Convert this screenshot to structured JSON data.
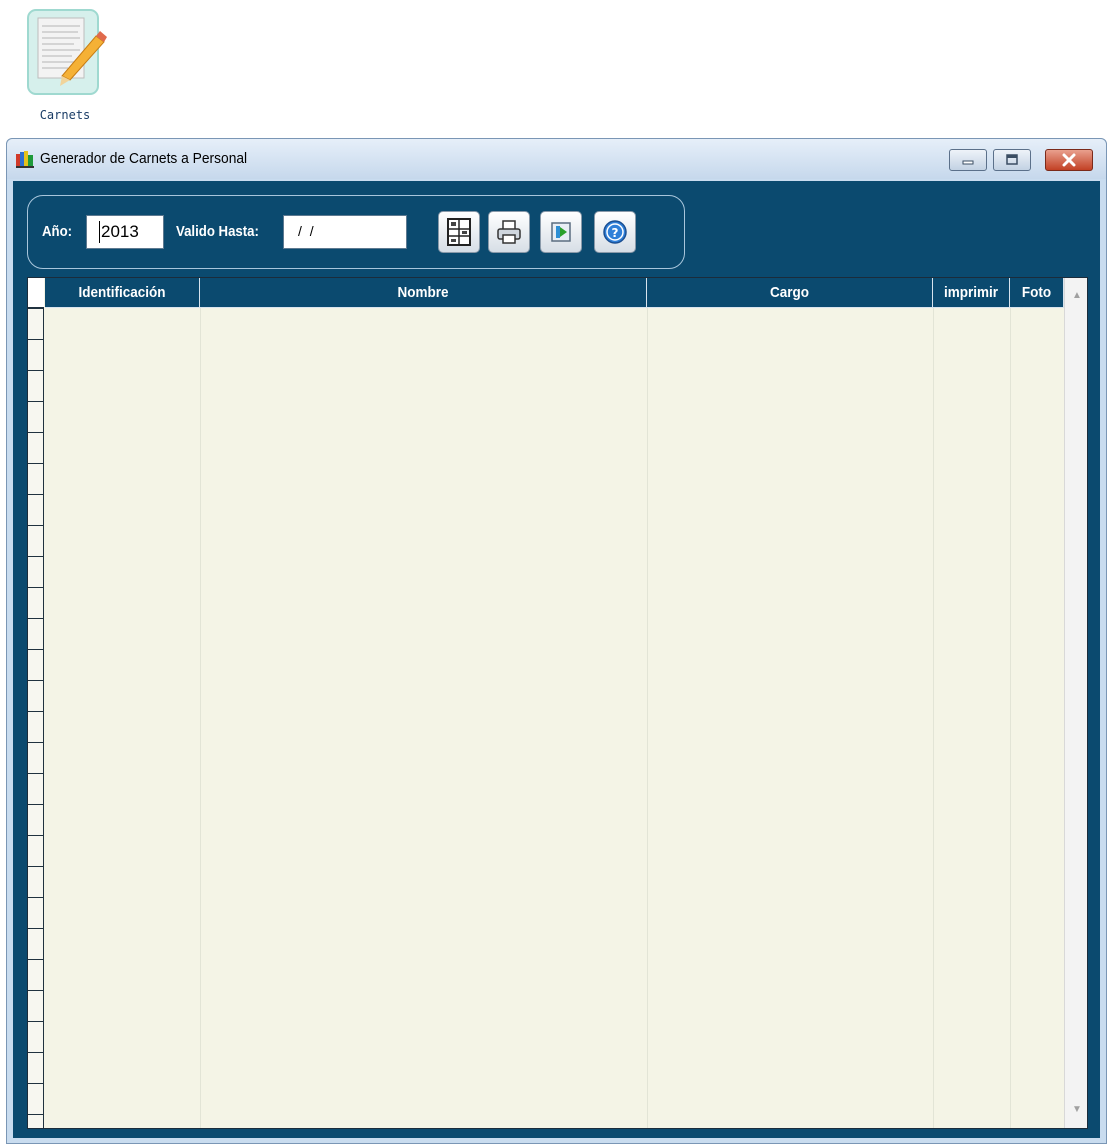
{
  "desktop": {
    "icon_label": "Carnets",
    "icon_name": "notepad-pencil-icon"
  },
  "window": {
    "title": "Generador de Carnets a Personal",
    "app_icon": "books-icon",
    "controls": [
      "minimize-icon",
      "maximize-icon",
      "close-icon"
    ]
  },
  "toolbar": {
    "year_label": "Año:",
    "year_value": "2013",
    "valid_label": "Valido Hasta:",
    "valid_value": "/ /",
    "buttons": [
      "form-icon",
      "print-icon",
      "export-icon",
      "help-icon"
    ]
  },
  "grid": {
    "columns": [
      "Identificación",
      "Nombre",
      "Cargo",
      "imprimir",
      "Foto"
    ],
    "rows": []
  },
  "colors": {
    "client_bg": "#0b4a6f",
    "grid_bg": "#f4f4e6",
    "header_bg": "#0b4a6f",
    "header_text": "#ffffff"
  }
}
